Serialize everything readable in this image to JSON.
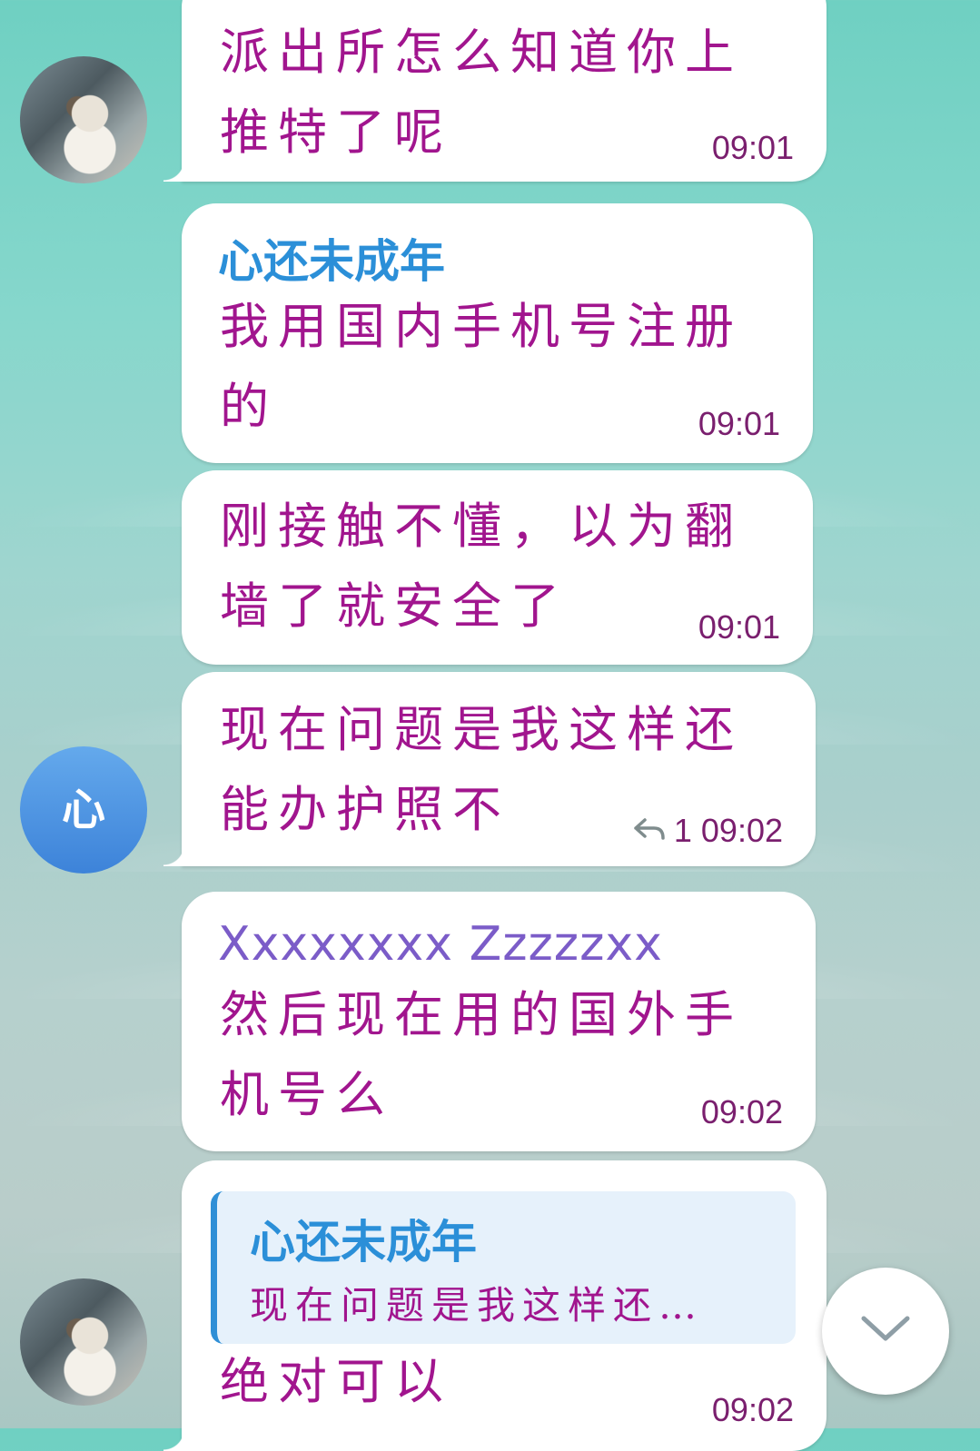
{
  "messages": [
    {
      "text": "派出所怎么知道你上\n推特了呢",
      "time": "09:01"
    },
    {
      "sender": "心还未成年",
      "sender_color": "#2b8fd8",
      "text": "我用国内手机号注册\n的",
      "time": "09:01"
    },
    {
      "text": "刚接触不懂，以为翻\n墙了就安全了",
      "time": "09:01"
    },
    {
      "text": "现在问题是我这样还\n能办护照不",
      "reply_count": "1",
      "time": "09:02"
    },
    {
      "sender": "Xxxxxxxx Zzzzzxx",
      "sender_color": "#7b5cc8",
      "text": "然后现在用的国外手\n机号么",
      "time": "09:02"
    },
    {
      "quote": {
        "sender": "心还未成年",
        "text": "现在问题是我这样还…"
      },
      "text": "绝对可以",
      "time": "09:02"
    }
  ],
  "avatars": {
    "letter": "心"
  },
  "icons": {
    "reply": "reply-arrow-icon",
    "scroll": "chevron-down-icon"
  }
}
